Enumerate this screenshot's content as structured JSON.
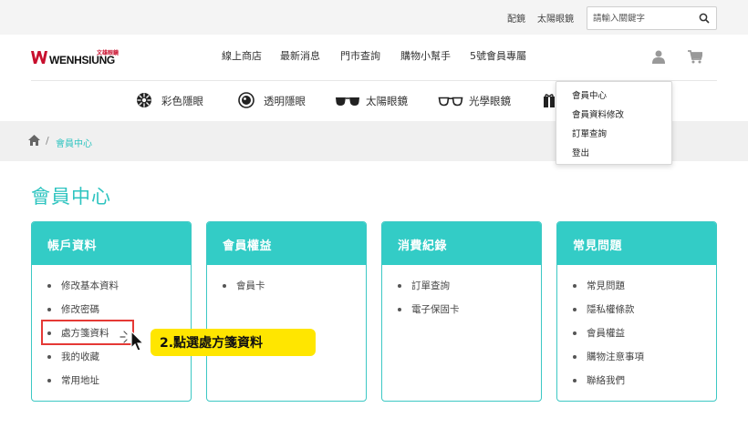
{
  "topbar": {
    "links": [
      "配鏡",
      "太陽眼鏡"
    ],
    "search": {
      "placeholder": "請輸入關鍵字",
      "value": ""
    }
  },
  "header": {
    "logo_text": "WENHSIUNG",
    "logo_cn": "文雄眼鏡",
    "nav": [
      "線上商店",
      "最新消息",
      "門市查詢",
      "購物小幫手",
      "5號會員專屬"
    ]
  },
  "categories": [
    {
      "label": "彩色隱眼",
      "icon": "flower-lens-icon"
    },
    {
      "label": "透明隱眼",
      "icon": "contact-lens-icon"
    },
    {
      "label": "太陽眼鏡",
      "icon": "sunglasses-icon"
    },
    {
      "label": "光學眼鏡",
      "icon": "eyeglasses-icon"
    }
  ],
  "breadcrumb": {
    "current": "會員中心",
    "separator": "/"
  },
  "user_menu": [
    "會員中心",
    "會員資料修改",
    "訂單查詢",
    "登出"
  ],
  "page_title": "會員中心",
  "cards": [
    {
      "title": "帳戶資料",
      "items": [
        "修改基本資料",
        "修改密碼",
        "處方箋資料",
        "我的收藏",
        "常用地址"
      ]
    },
    {
      "title": "會員權益",
      "items": [
        "會員卡"
      ]
    },
    {
      "title": "消費紀錄",
      "items": [
        "訂單查詢",
        "電子保固卡"
      ]
    },
    {
      "title": "常見問題",
      "items": [
        "常見問題",
        "隱私權條款",
        "會員權益",
        "購物注意事項",
        "聯絡我們"
      ]
    }
  ],
  "annotation": {
    "callout": "2.點選處方箋資料"
  },
  "colors": {
    "accent": "#33ccc6",
    "highlight": "#ffe600",
    "marker": "#e53935",
    "brand_red": "#c8102e"
  }
}
